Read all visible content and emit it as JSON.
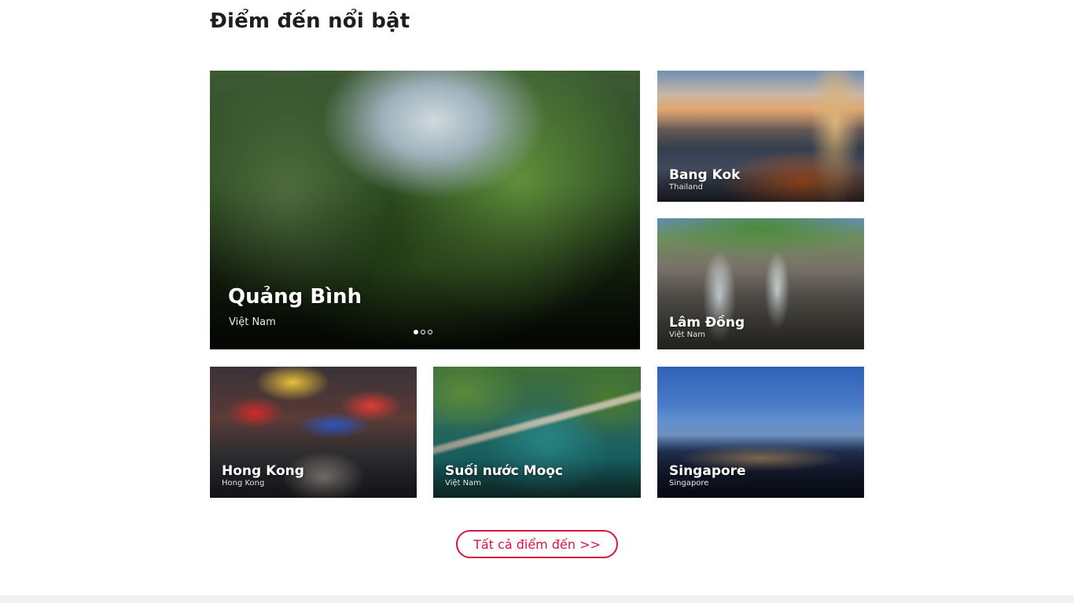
{
  "section": {
    "title": "Điểm đến nổi bật"
  },
  "featured": {
    "name": "Quảng Bình",
    "country": "Việt Nam",
    "slides_total": 3,
    "active_slide": 1
  },
  "destinations": [
    {
      "name": "Bang Kok",
      "country": "Thailand"
    },
    {
      "name": "Lâm Đồng",
      "country": "Việt Nam"
    },
    {
      "name": "Hong Kong",
      "country": "Hong Kong"
    },
    {
      "name": "Suối nước Moọc",
      "country": "Việt Nam"
    },
    {
      "name": "Singapore",
      "country": "Singapore"
    }
  ],
  "actions": {
    "all_destinations_label": "Tất cả điểm đến >>"
  },
  "colors": {
    "accent": "#d8153f",
    "title_text": "#1e1e1e"
  }
}
